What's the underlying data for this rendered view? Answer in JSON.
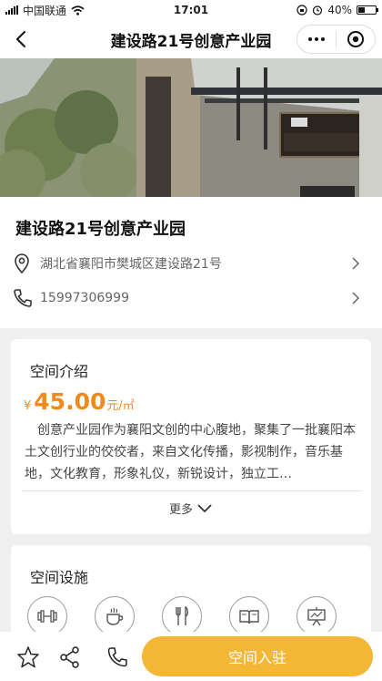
{
  "status_bar": {
    "carrier": "中国联通",
    "time": "17:01",
    "battery": "40%",
    "battery_level": 0.4
  },
  "nav": {
    "title": "建设路21号创意产业园"
  },
  "park": {
    "name": "建设路21号创意产业园",
    "address": "湖北省襄阳市樊城区建设路21号",
    "phone": "15997306999"
  },
  "intro": {
    "title": "空间介绍",
    "currency": "¥",
    "price": "45.00",
    "unit": "元/㎡",
    "description": "创意产业园作为襄阳文创的中心腹地，聚集了一批襄阳本土文创行业的佼佼者，来自文化传播，影视制作，音乐基地，文化教育，形象礼仪，新锐设计，独立工…",
    "more_label": "更多"
  },
  "facilities": {
    "title": "空间设施",
    "items": [
      "gym-icon",
      "coffee-icon",
      "restaurant-icon",
      "book-icon",
      "presentation-icon"
    ]
  },
  "bottom_bar": {
    "join_label": "空间入驻"
  },
  "colors": {
    "accent": "#f08a1c",
    "button": "#f3b635",
    "background": "#f0f0f0"
  }
}
